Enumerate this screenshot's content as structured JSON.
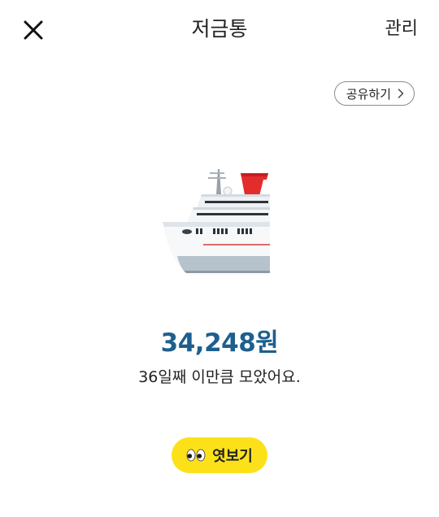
{
  "header": {
    "title": "저금통",
    "manage_label": "관리",
    "close_icon": "close-icon"
  },
  "share": {
    "label": "공유하기",
    "icon": "chevron-right-icon"
  },
  "main": {
    "image_icon": "ship-icon",
    "amount": "34,248원",
    "subtext": "36일째 이만큼 모았어요.",
    "peek_label": "엿보기",
    "peek_icon": "eyes-icon"
  },
  "colors": {
    "amount": "#1d5f8f",
    "peek_button": "#fce11a"
  }
}
